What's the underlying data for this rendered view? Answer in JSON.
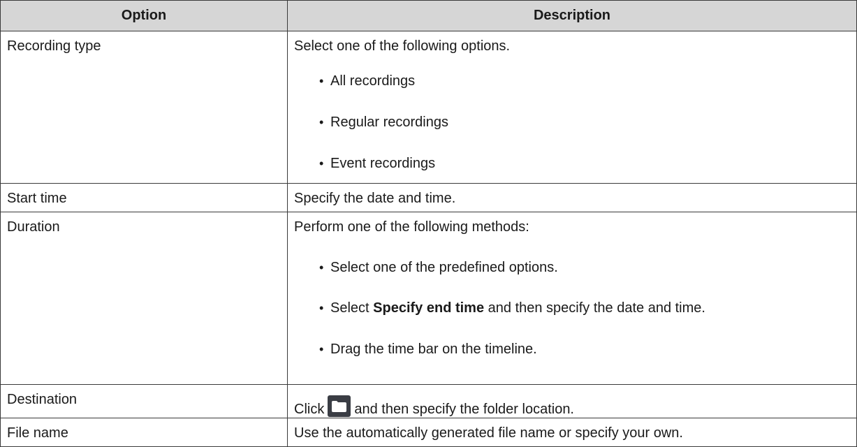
{
  "header": {
    "option": "Option",
    "description": "Description"
  },
  "rows": {
    "recording_type": {
      "option": "Recording type",
      "intro": "Select one of the following options.",
      "bullets": [
        "All recordings",
        "Regular recordings",
        "Event recordings"
      ]
    },
    "start_time": {
      "option": "Start time",
      "description": "Specify the date and time."
    },
    "duration": {
      "option": "Duration",
      "intro": "Perform one of the following methods:",
      "bullet1": "Select one of the predefined options.",
      "bullet2_pre": "Select ",
      "bullet2_bold": "Specify end time",
      "bullet2_post": " and then specify the date and time.",
      "bullet3": "Drag the time bar on the timeline."
    },
    "destination": {
      "option": "Destination",
      "pre": "Click",
      "icon": "folder-icon",
      "post": "and then specify the folder location."
    },
    "file_name": {
      "option": "File name",
      "description": "Use the automatically generated file name or specify your own."
    }
  },
  "bullet_glyph": "•",
  "colors": {
    "header_bg": "#d6d6d6",
    "border": "#3a3a3a",
    "folder_button_bg": "#3a3d44"
  }
}
